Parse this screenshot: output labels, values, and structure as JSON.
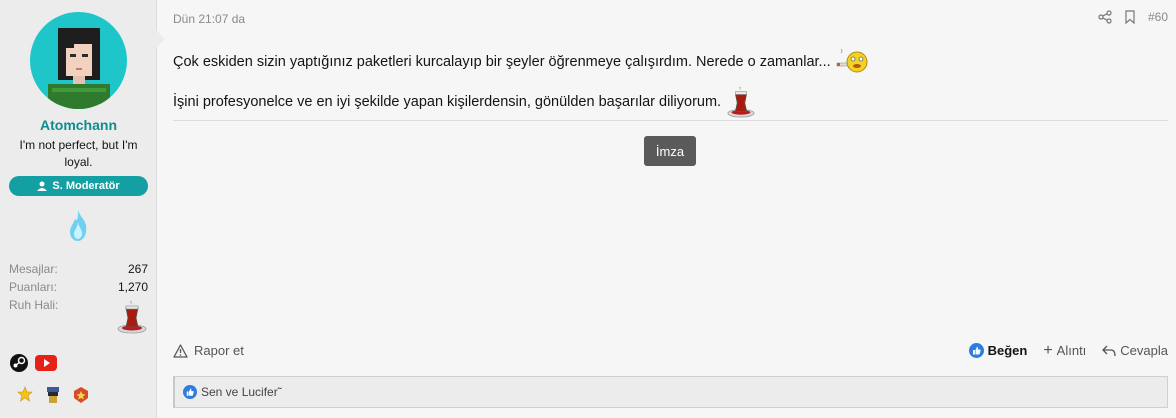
{
  "user": {
    "name": "Atomchann",
    "title": "I'm not perfect, but I'm loyal.",
    "role": "S. Moderatör",
    "stats": [
      {
        "label": "Mesajlar:",
        "value": "267"
      },
      {
        "label": "Puanları:",
        "value": "1,270"
      },
      {
        "label": "Ruh Hali:",
        "value": ""
      }
    ]
  },
  "post": {
    "date": "Dün 21:07 da",
    "number": "#60",
    "lines": [
      "Çok eskiden sizin yaptığınız paketleri kurcalayıp bir şeyler öğrenmeye çalışırdım. Nerede o zamanlar...",
      "İşini profesyonelce ve en iyi şekilde yapan kişilerdensin, gönülden başarılar diliyorum."
    ],
    "signature_label": "İmza"
  },
  "footer": {
    "report": "Rapor et",
    "like": "Beğen",
    "quote": "Alıntı",
    "reply": "Cevapla"
  },
  "reactions": {
    "text": "Sen ve Lucifer˜"
  },
  "colors": {
    "accent": "#14a0a3",
    "username": "#128b8e",
    "like_blue": "#2d7de0"
  }
}
